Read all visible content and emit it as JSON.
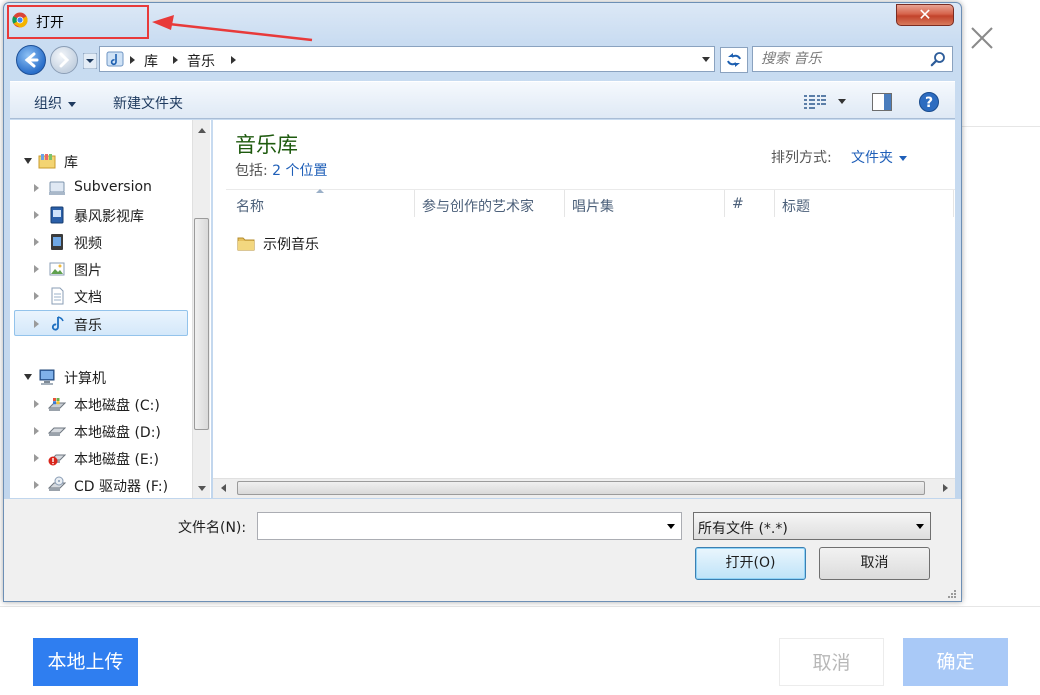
{
  "background": {
    "upload_button": "本地上传",
    "cancel_button": "取消",
    "confirm_button": "确定"
  },
  "dialog": {
    "title": "打开",
    "address": {
      "segments": [
        "库",
        "音乐"
      ]
    },
    "search": {
      "placeholder": "搜索 音乐"
    },
    "toolbar": {
      "organize": "组织",
      "new_folder": "新建文件夹"
    },
    "nav_tree": {
      "library_label": "库",
      "library_items": [
        "Subversion",
        "暴风影视库",
        "视频",
        "图片",
        "文档",
        "音乐"
      ],
      "computer_label": "计算机",
      "computer_items": [
        "本地磁盘 (C:)",
        "本地磁盘 (D:)",
        "本地磁盘 (E:)",
        "CD 驱动器 (F:)"
      ]
    },
    "content": {
      "title": "音乐库",
      "includes_prefix": "包括: ",
      "includes_link": "2 个位置",
      "sort_label": "排列方式:",
      "sort_value": "文件夹",
      "columns": [
        "名称",
        "参与创作的艺术家",
        "唱片集",
        "#",
        "标题"
      ],
      "items": [
        "示例音乐"
      ]
    },
    "bottom": {
      "filename_label": "文件名(N):",
      "filename_value": "",
      "filetype_value": "所有文件 (*.*)",
      "open_button": "打开(O)",
      "cancel_button": "取消"
    }
  },
  "colors": {
    "accent_blue": "#2f7ef0",
    "highlight_red": "#e83a3a",
    "library_green": "#1e5a0e"
  }
}
